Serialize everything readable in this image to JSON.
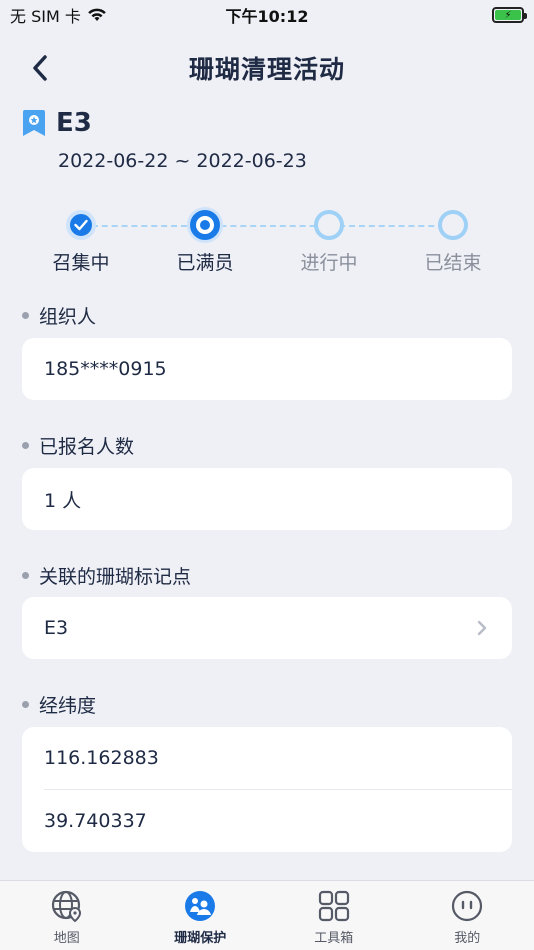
{
  "status_bar": {
    "carrier": "无 SIM 卡",
    "time": "下午10:12"
  },
  "nav": {
    "title": "珊瑚清理活动"
  },
  "activity": {
    "code": "E3",
    "date_range": "2022-06-22 ~ 2022-06-23"
  },
  "steps": [
    {
      "label": "召集中",
      "state": "done"
    },
    {
      "label": "已满员",
      "state": "current"
    },
    {
      "label": "进行中",
      "state": "pending"
    },
    {
      "label": "已结束",
      "state": "pending"
    }
  ],
  "fields": {
    "organizer": {
      "label": "组织人",
      "value": "185****0915"
    },
    "registered": {
      "label": "已报名人数",
      "value": "1 人"
    },
    "marker": {
      "label": "关联的珊瑚标记点",
      "value": "E3"
    },
    "coords": {
      "label": "经纬度",
      "longitude": "116.162883",
      "latitude": "39.740337"
    }
  },
  "tabs": [
    {
      "label": "地图",
      "icon": "globe-pin-icon"
    },
    {
      "label": "珊瑚保护",
      "icon": "coral-protect-icon",
      "active": true
    },
    {
      "label": "工具箱",
      "icon": "grid-icon"
    },
    {
      "label": "我的",
      "icon": "smiley-icon"
    }
  ],
  "colors": {
    "accent": "#1a7be8",
    "background": "#eef0f5",
    "text": "#1f2a44",
    "pending": "#8a8f9c"
  }
}
